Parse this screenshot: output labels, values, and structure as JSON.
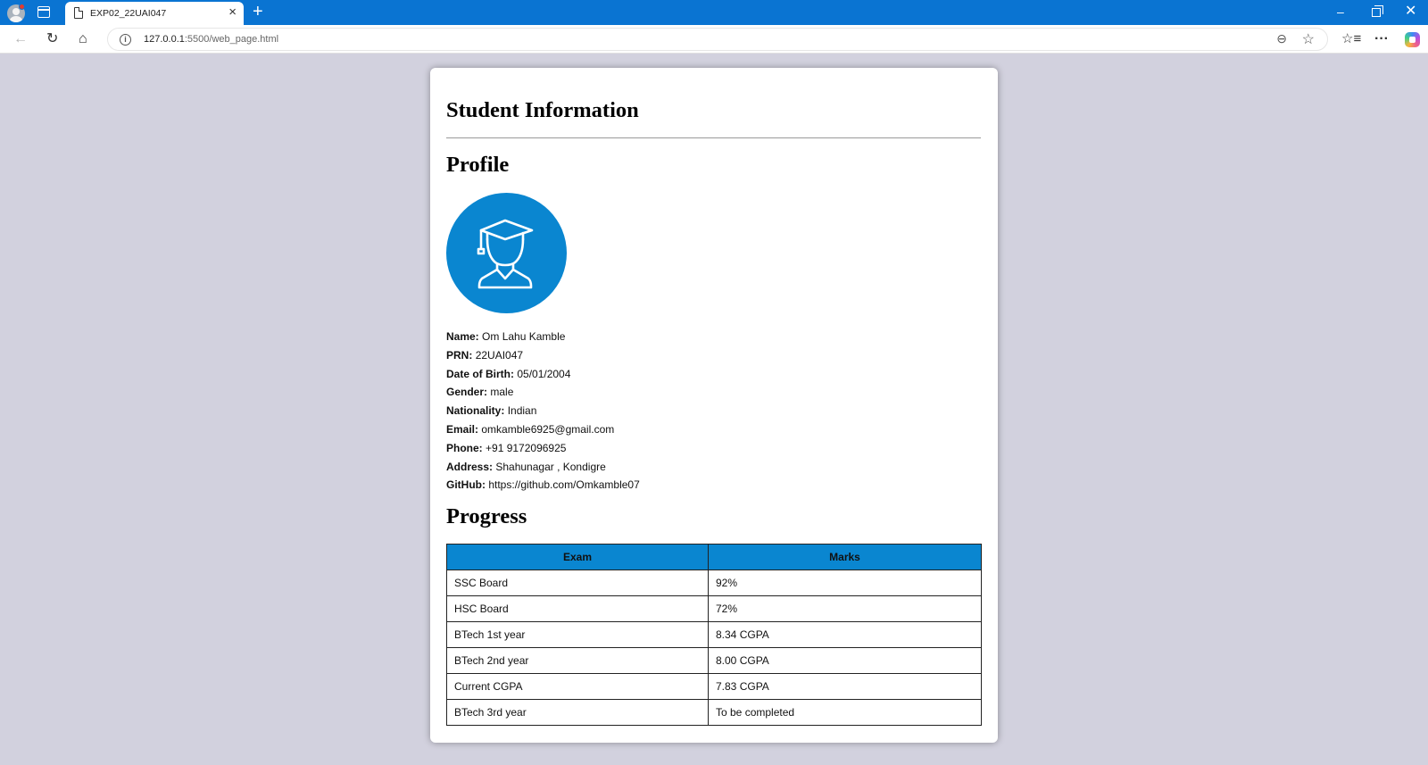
{
  "browser": {
    "tab_title": "EXP02_22UAI047",
    "url_host": "127.0.0.1",
    "url_rest": ":5500/web_page.html"
  },
  "page": {
    "title": "Student Information",
    "profile_heading": "Profile",
    "progress_heading": "Progress",
    "avatar_icon": "graduate-student-icon",
    "accent_color": "#0a86d0"
  },
  "profile": [
    {
      "label": "Name:",
      "value": "Om Lahu Kamble"
    },
    {
      "label": "PRN:",
      "value": "22UAI047"
    },
    {
      "label": "Date of Birth:",
      "value": "05/01/2004"
    },
    {
      "label": "Gender:",
      "value": "male"
    },
    {
      "label": "Nationality:",
      "value": "Indian"
    },
    {
      "label": "Email:",
      "value": "omkamble6925@gmail.com"
    },
    {
      "label": "Phone:",
      "value": "+91 9172096925"
    },
    {
      "label": "Address:",
      "value": "Shahunagar , Kondigre"
    },
    {
      "label": "GitHub:",
      "value": "https://github.com/Omkamble07"
    }
  ],
  "progress": {
    "headers": [
      "Exam",
      "Marks"
    ],
    "rows": [
      [
        "SSC Board",
        "92%"
      ],
      [
        "HSC Board",
        "72%"
      ],
      [
        "BTech 1st year",
        "8.34 CGPA"
      ],
      [
        "BTech 2nd year",
        "8.00 CGPA"
      ],
      [
        "Current CGPA",
        "7.83 CGPA"
      ],
      [
        "BTech 3rd year",
        "To be completed"
      ]
    ]
  }
}
